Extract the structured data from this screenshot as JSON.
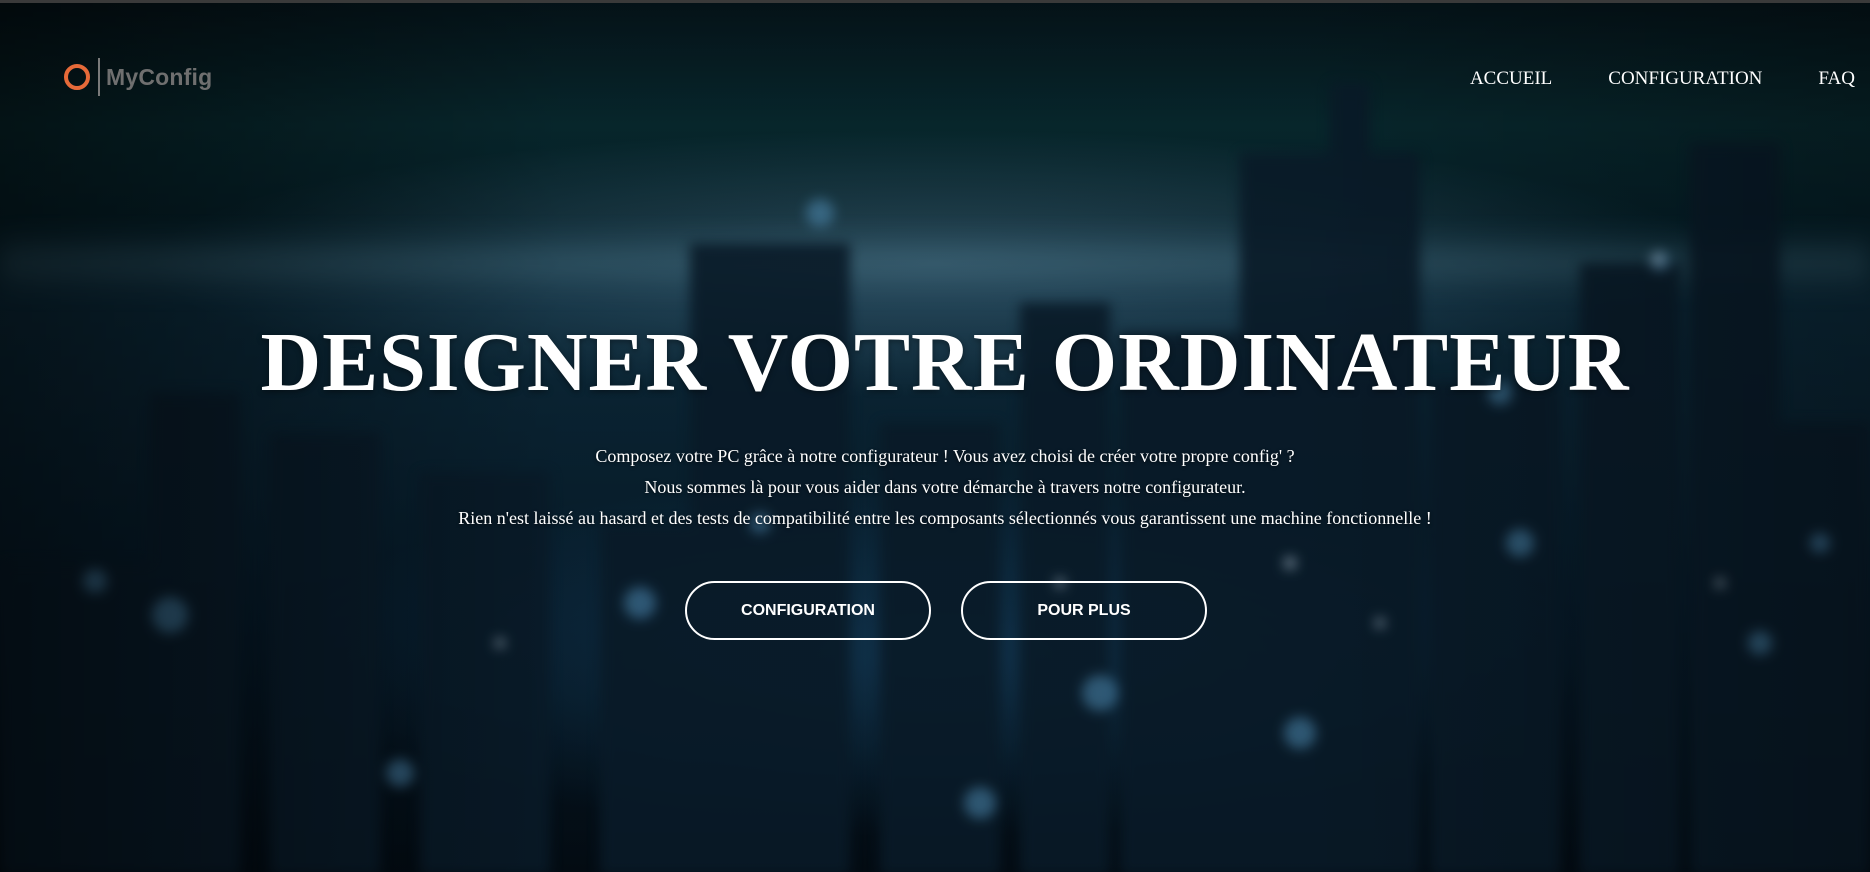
{
  "brand": {
    "name": "MyConfig",
    "logo_icon": "ring-logo-icon",
    "accent_color": "#e66a39"
  },
  "nav": {
    "items": [
      {
        "label": "ACCUEIL"
      },
      {
        "label": "CONFIGURATION"
      },
      {
        "label": "FAQ"
      }
    ]
  },
  "hero": {
    "title": "DESIGNER VOTRE ORDINATEUR",
    "lines": [
      "Composez votre PC grâce à notre configurateur ! Vous avez choisi de créer votre propre config' ?",
      "Nous sommes là pour vous aider dans votre démarche à travers notre configurateur.",
      "Rien n'est laissé au hasard et des tests de compatibilité entre les composants sélectionnés vous garantissent une machine fonctionnelle !"
    ],
    "buttons": [
      {
        "label": "CONFIGURATION"
      },
      {
        "label": "POUR PLUS"
      }
    ]
  }
}
